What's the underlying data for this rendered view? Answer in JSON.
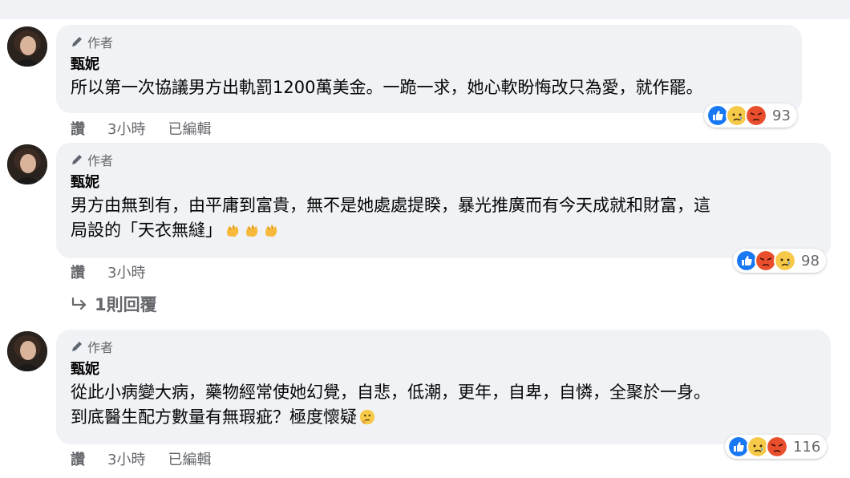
{
  "comments": [
    {
      "author_badge": "作者",
      "author_name": "甄妮",
      "lines": [
        "所以第一次協議男方出軌罰1200萬美金。一跪一求，她心軟盼悔改只為愛，就作罷。"
      ],
      "reactions": [
        "like",
        "sad",
        "angry"
      ],
      "reaction_count": "93",
      "actions": {
        "like": "讚",
        "time": "3小時",
        "edited": "已編輯"
      }
    },
    {
      "author_badge": "作者",
      "author_name": "甄妮",
      "lines": [
        "男方由無到有，由平庸到富貴，無不是她處處提睽，暴光推廣而有今天成就和財富，這",
        "局設的「天衣無縫」"
      ],
      "inline_emojis": [
        "clapping-hands",
        "clapping-hands",
        "clapping-hands"
      ],
      "reactions": [
        "like",
        "angry",
        "sad"
      ],
      "reaction_count": "98",
      "actions": {
        "like": "讚",
        "time": "3小時"
      },
      "replies_label": "1則回覆"
    },
    {
      "author_badge": "作者",
      "author_name": "甄妮",
      "lines": [
        "從此小病變大病，藥物經常使她幻覺，自悲，低潮，更年，自卑，自憐，全聚於一身。",
        "到底醫生配方數量有無瑕疵？極度懷疑"
      ],
      "inline_emojis": [
        "thinking-face"
      ],
      "reactions": [
        "like",
        "sad",
        "angry"
      ],
      "reaction_count": "116",
      "actions": {
        "like": "讚",
        "time": "3小時",
        "edited": "已編輯"
      }
    }
  ],
  "colors": {
    "bubble_bg": "#f0f2f5",
    "secondary_text": "#65676b",
    "like_blue": "#1877f2",
    "sad_yellow": "#f7c948",
    "angry_red": "#e94f2d"
  }
}
